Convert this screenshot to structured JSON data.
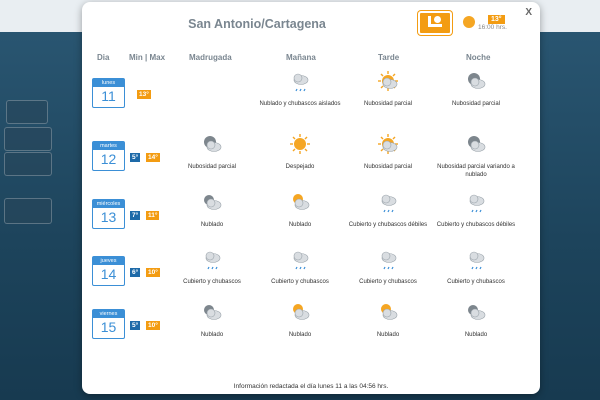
{
  "modal": {
    "city": "San Antonio/Cartagena",
    "close_label": "X",
    "current": {
      "temp": "13°",
      "time": "16:00 hrs."
    },
    "footer": "Información redactada el día lunes 11 a las 04:56 hrs."
  },
  "headers": {
    "dia": "Dia",
    "minmax": "Min | Max",
    "madrugada": "Madrugada",
    "manana": "Mañana",
    "tarde": "Tarde",
    "noche": "Noche"
  },
  "days": [
    {
      "weekday": "lunes",
      "day": "11",
      "min": "",
      "max": "13°",
      "periods": [
        null,
        {
          "icon": "cloud-rain-icon",
          "label": "Nublado y chubascos aislados"
        },
        {
          "icon": "sun-cloud-icon",
          "label": "Nubosidad parcial"
        },
        {
          "icon": "moon-cloud-icon",
          "label": "Nubosidad parcial"
        }
      ]
    },
    {
      "weekday": "martes",
      "day": "12",
      "min": "5°",
      "max": "14°",
      "periods": [
        {
          "icon": "moon-cloud-icon",
          "label": "Nubosidad parcial"
        },
        {
          "icon": "sun-icon",
          "label": "Despejado"
        },
        {
          "icon": "sun-cloud-icon",
          "label": "Nubosidad parcial"
        },
        {
          "icon": "moon-cloud-icon",
          "label": "Nubosidad parcial variando a nublado"
        }
      ]
    },
    {
      "weekday": "miércoles",
      "day": "13",
      "min": "7°",
      "max": "11°",
      "periods": [
        {
          "icon": "cloud-moon-icon",
          "label": "Nublado"
        },
        {
          "icon": "cloud-sun-icon",
          "label": "Nublado"
        },
        {
          "icon": "cloud-rain-icon",
          "label": "Cubierto y chubascos débiles"
        },
        {
          "icon": "cloud-rain-icon",
          "label": "Cubierto y chubascos débiles"
        }
      ]
    },
    {
      "weekday": "jueves",
      "day": "14",
      "min": "6°",
      "max": "10°",
      "periods": [
        {
          "icon": "cloud-rain-icon",
          "label": "Cubierto y chubascos"
        },
        {
          "icon": "cloud-rain-icon",
          "label": "Cubierto y chubascos"
        },
        {
          "icon": "cloud-rain-icon",
          "label": "Cubierto y chubascos"
        },
        {
          "icon": "cloud-rain-icon",
          "label": "Cubierto y chubascos"
        }
      ]
    },
    {
      "weekday": "viernes",
      "day": "15",
      "min": "5°",
      "max": "10°",
      "periods": [
        {
          "icon": "cloud-moon-icon",
          "label": "Nublado"
        },
        {
          "icon": "cloud-sun-icon",
          "label": "Nublado"
        },
        {
          "icon": "cloud-sun-icon",
          "label": "Nublado"
        },
        {
          "icon": "cloud-moon-icon",
          "label": "Nublado"
        }
      ]
    }
  ]
}
